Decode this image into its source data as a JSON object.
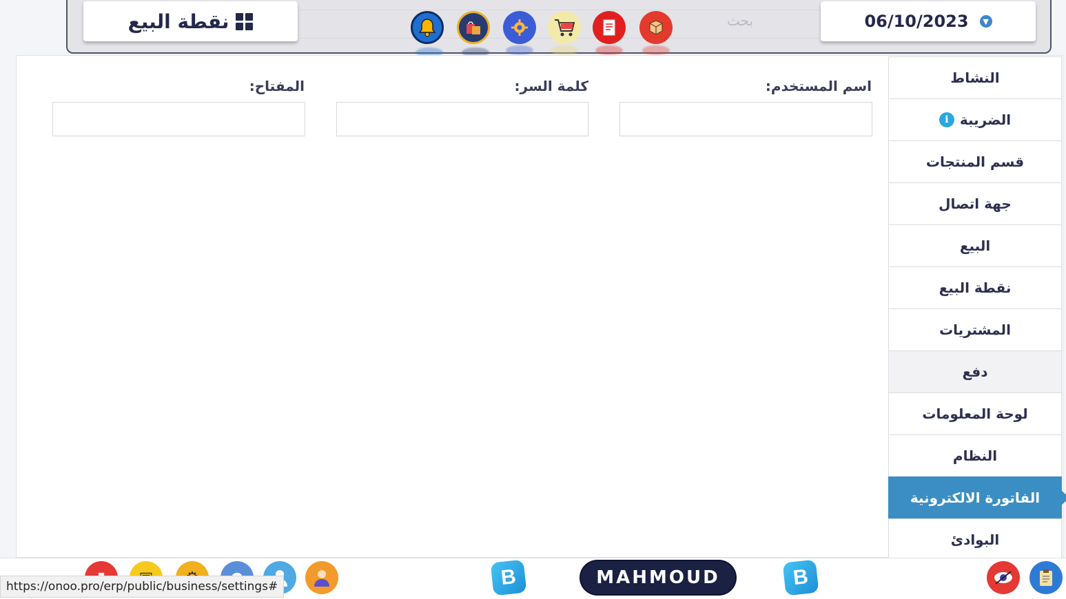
{
  "header": {
    "brand_label": "نقطة البيع",
    "date": "06/10/2023",
    "search_hint": "بحث",
    "icons": [
      "bell-icon",
      "shopping-bags-icon",
      "gear-network-icon",
      "shopping-cart-icon",
      "document-icon",
      "package-icon"
    ]
  },
  "form": {
    "username_label": "اسم المستخدم:",
    "password_label": "كلمة السر:",
    "key_label": "المفتاح:",
    "username_value": "",
    "password_value": "",
    "key_value": ""
  },
  "sidebar": {
    "items": [
      {
        "label": "النشاط"
      },
      {
        "label": "الضريبة"
      },
      {
        "label": "قسم المنتجات"
      },
      {
        "label": "جهة اتصال"
      },
      {
        "label": "البيع"
      },
      {
        "label": "نقطة البيع"
      },
      {
        "label": "المشتريات"
      },
      {
        "label": "دفع"
      },
      {
        "label": "لوحة المعلومات"
      },
      {
        "label": "النظام"
      },
      {
        "label": "الفاتورة الالكترونية"
      },
      {
        "label": "البوادئ"
      }
    ],
    "active_index": 10
  },
  "bottombar": {
    "username": "MAHMOUD",
    "logo_letter": "B",
    "status_url": "https://onoo.pro/erp/public/business/settings#"
  },
  "colors": {
    "accent": "#3a8ec3",
    "header_text": "#25284a",
    "user_pill": "#1a2143"
  }
}
